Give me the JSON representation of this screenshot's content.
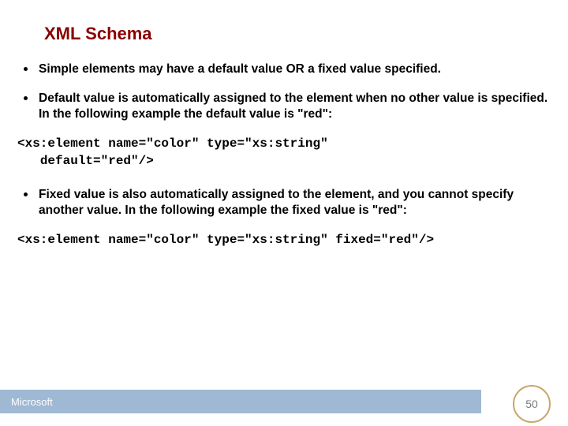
{
  "title": "XML Schema",
  "bullets": {
    "b1": "Simple elements may have a default value OR a fixed value specified.",
    "b2": "Default value is automatically assigned to the element when no other value is specified. In the following example the default value is \"red\":",
    "b3": "Fixed value is also automatically assigned to the element, and you cannot specify another value.  In the following example the fixed value is \"red\":"
  },
  "code": {
    "c1": "<xs:element name=\"color\" type=\"xs:string\"\n   default=\"red\"/>",
    "c2": "<xs:element name=\"color\" type=\"xs:string\" fixed=\"red\"/>"
  },
  "footer": {
    "brand": "Microsoft"
  },
  "page": "50"
}
